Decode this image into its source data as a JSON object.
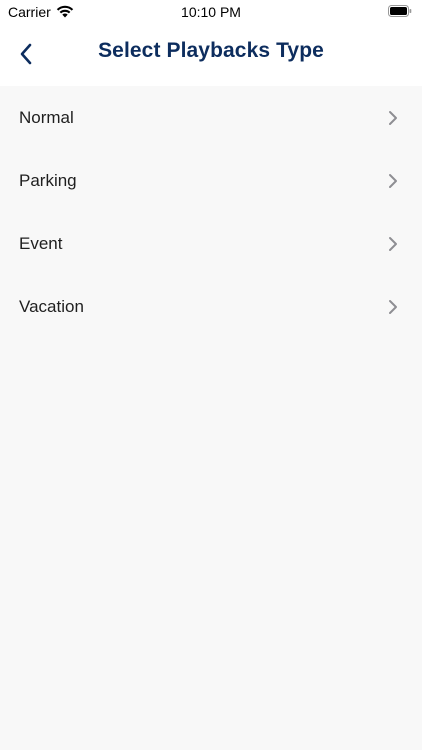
{
  "status_bar": {
    "carrier": "Carrier",
    "time": "10:10 PM",
    "icons": [
      "wifi-icon",
      "battery-icon"
    ]
  },
  "nav": {
    "title": "Select Playbacks Type",
    "back_icon": "chevron-left-icon",
    "title_color": "#0d2d5e"
  },
  "list": {
    "items": [
      {
        "label": "Normal",
        "icon": "chevron-right-icon"
      },
      {
        "label": "Parking",
        "icon": "chevron-right-icon"
      },
      {
        "label": "Event",
        "icon": "chevron-right-icon"
      },
      {
        "label": "Vacation",
        "icon": "chevron-right-icon"
      }
    ]
  },
  "colors": {
    "background": "#f8f8f8",
    "header": "#ffffff",
    "accent": "#0d2d5e",
    "chevron": "#8e8e93"
  }
}
